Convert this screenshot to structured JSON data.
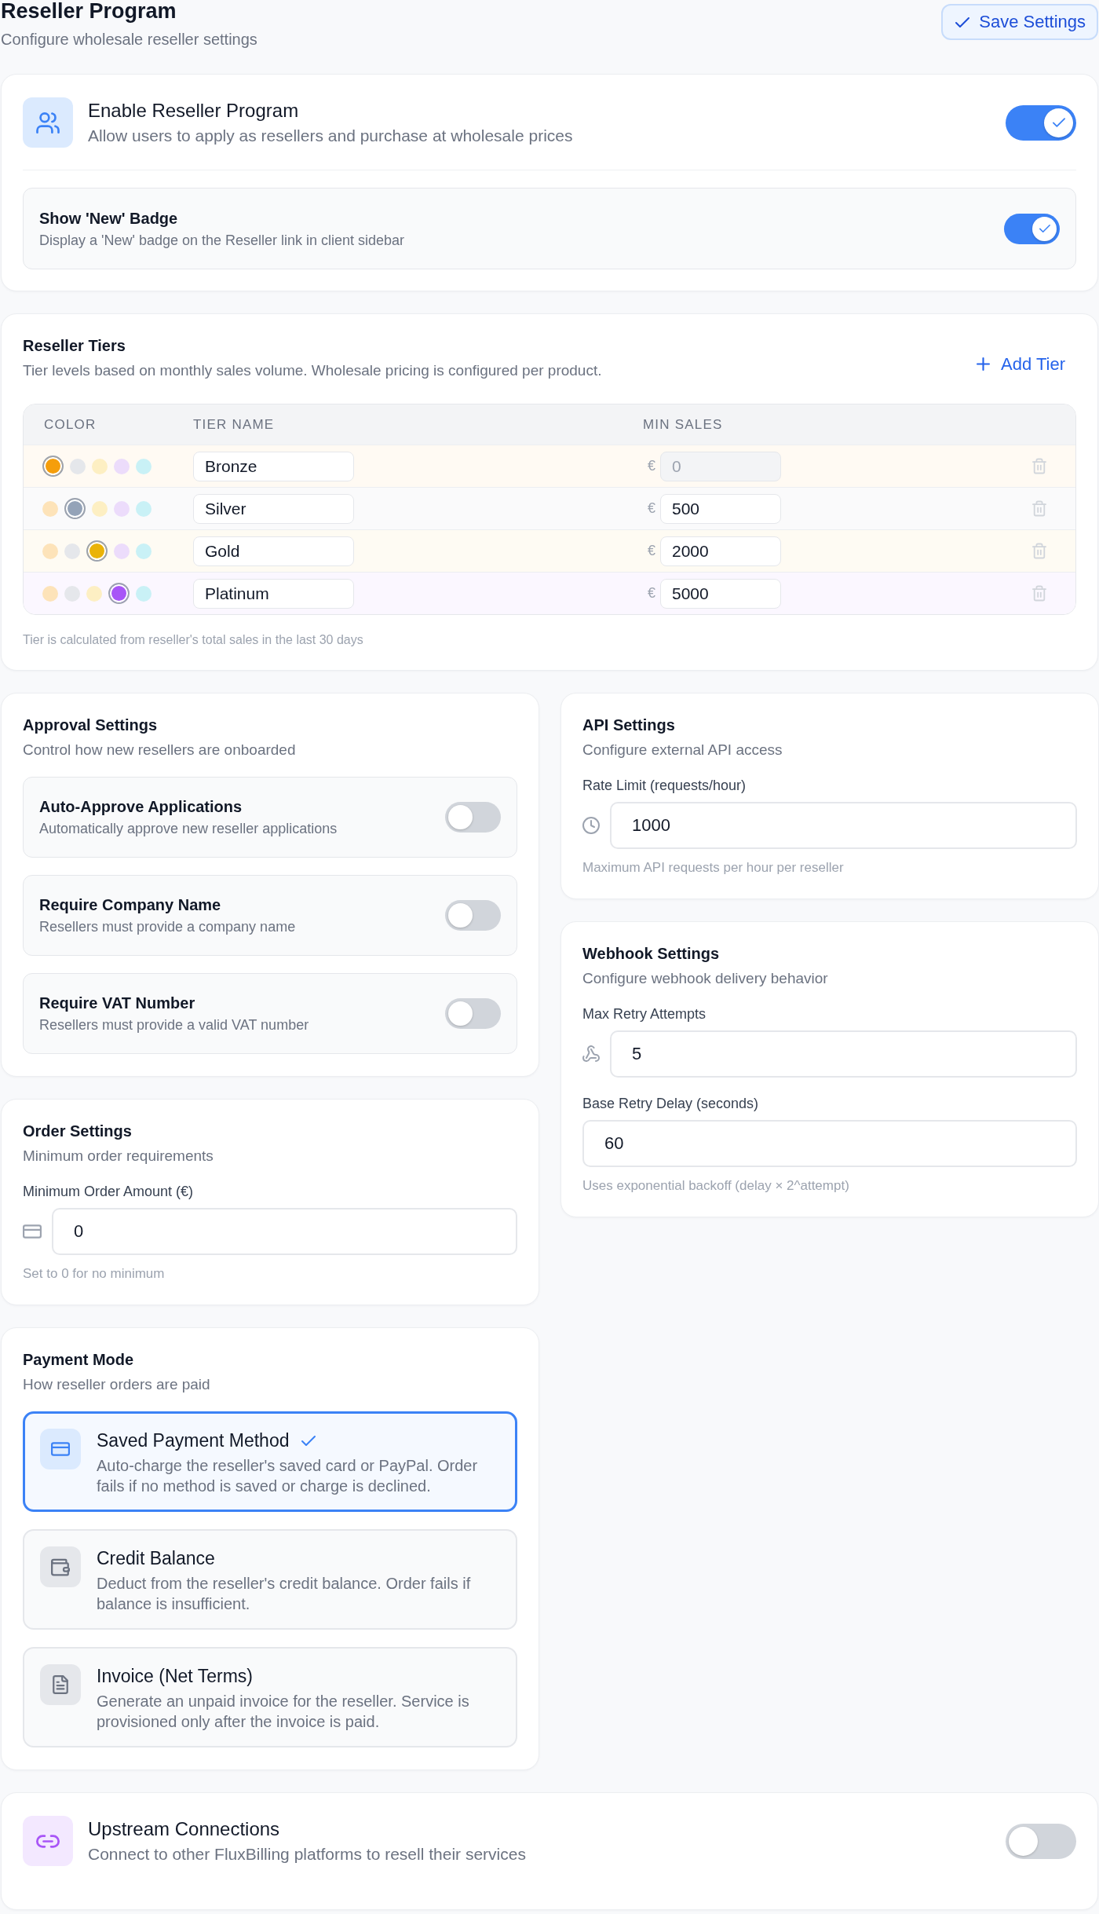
{
  "header": {
    "title": "Reseller Program",
    "subtitle": "Configure wholesale reseller settings",
    "save_button": "Save Settings"
  },
  "program": {
    "title": "Enable Reseller Program",
    "description": "Allow users to apply as resellers and purchase at wholesale prices",
    "on": true,
    "badge_setting": {
      "title": "Show 'New' Badge",
      "description": "Display a 'New' badge on the Reseller link in client sidebar",
      "on": true
    }
  },
  "tiers": {
    "title": "Reseller Tiers",
    "description": "Tier levels based on monthly sales volume. Wholesale pricing is configured per product.",
    "add_button": "Add Tier",
    "columns": [
      "COLOR",
      "TIER NAME",
      "MIN SALES"
    ],
    "rows": [
      {
        "swatches": [
          {
            "color": "#f59e0b",
            "selected": true
          },
          {
            "color": "#e5e7eb",
            "selected": false
          },
          {
            "color": "#fdefc3",
            "selected": false
          },
          {
            "color": "#ecdcfb",
            "selected": false
          },
          {
            "color": "#c9f1f6",
            "selected": false
          }
        ],
        "name": "Bronze",
        "currency": "€",
        "min_sales": "0",
        "disabled": true
      },
      {
        "swatches": [
          {
            "color": "#fde3b9",
            "selected": false
          },
          {
            "color": "#94a3b8",
            "selected": true
          },
          {
            "color": "#fdefc3",
            "selected": false
          },
          {
            "color": "#ecdcfb",
            "selected": false
          },
          {
            "color": "#c9f1f6",
            "selected": false
          }
        ],
        "name": "Silver",
        "currency": "€",
        "min_sales": "500",
        "disabled": false
      },
      {
        "swatches": [
          {
            "color": "#fde3b9",
            "selected": false
          },
          {
            "color": "#e5e7eb",
            "selected": false
          },
          {
            "color": "#eab308",
            "selected": true
          },
          {
            "color": "#ecdcfb",
            "selected": false
          },
          {
            "color": "#c9f1f6",
            "selected": false
          }
        ],
        "name": "Gold",
        "currency": "€",
        "min_sales": "2000",
        "disabled": false
      },
      {
        "swatches": [
          {
            "color": "#fde3b9",
            "selected": false
          },
          {
            "color": "#e5e7eb",
            "selected": false
          },
          {
            "color": "#fdefc3",
            "selected": false
          },
          {
            "color": "#a855f7",
            "selected": true
          },
          {
            "color": "#c9f1f6",
            "selected": false
          }
        ],
        "name": "Platinum",
        "currency": "€",
        "min_sales": "5000",
        "disabled": false
      }
    ],
    "footnote": "Tier is calculated from reseller's total sales in the last 30 days"
  },
  "approval": {
    "title": "Approval Settings",
    "description": "Control how new resellers are onboarded",
    "options": [
      {
        "title": "Auto-Approve Applications",
        "description": "Automatically approve new reseller applications",
        "on": false
      },
      {
        "title": "Require Company Name",
        "description": "Resellers must provide a company name",
        "on": false
      },
      {
        "title": "Require VAT Number",
        "description": "Resellers must provide a valid VAT number",
        "on": false
      }
    ]
  },
  "order": {
    "title": "Order Settings",
    "description": "Minimum order requirements",
    "fields": [
      {
        "kind": "card",
        "label": "Minimum Order Amount (€)",
        "value": "0",
        "help": "Set to 0 for no minimum"
      }
    ]
  },
  "payment": {
    "title": "Payment Mode",
    "description": "How reseller orders are paid",
    "modes": [
      {
        "kind": "card",
        "title": "Saved Payment Method",
        "description": "Auto-charge the reseller's saved card or PayPal. Order fails if no method is saved or charge is declined.",
        "selected": true
      },
      {
        "kind": "wallet",
        "title": "Credit Balance",
        "description": "Deduct from the reseller's credit balance. Order fails if balance is insufficient.",
        "selected": false
      },
      {
        "kind": "invoice",
        "title": "Invoice (Net Terms)",
        "description": "Generate an unpaid invoice for the reseller. Service is provisioned only after the invoice is paid.",
        "selected": false
      }
    ]
  },
  "api": {
    "title": "API Settings",
    "description": "Configure external API access",
    "fields": [
      {
        "kind": "clock",
        "label": "Rate Limit (requests/hour)",
        "value": "1000",
        "help": "Maximum API requests per hour per reseller"
      }
    ]
  },
  "webhook": {
    "title": "Webhook Settings",
    "description": "Configure webhook delivery behavior",
    "fields": [
      {
        "kind": "webhook",
        "label": "Max Retry Attempts",
        "value": "5"
      },
      {
        "kind": "plain",
        "label": "Base Retry Delay (seconds)",
        "value": "60",
        "help": "Uses exponential backoff (delay × 2^attempt)"
      }
    ]
  },
  "upstream": {
    "title": "Upstream Connections",
    "description": "Connect to other FluxBilling platforms to resell their services",
    "on": false
  }
}
